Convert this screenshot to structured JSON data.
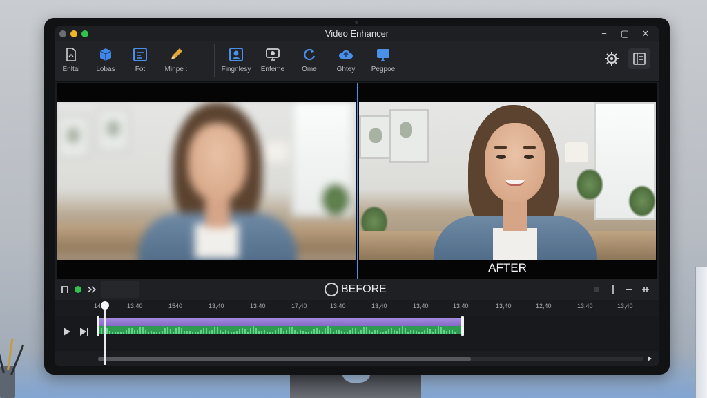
{
  "window": {
    "title": "Video Enhancer"
  },
  "toolbar": {
    "tools": [
      {
        "label": "Enltal",
        "icon": "file-icon"
      },
      {
        "label": "Lobas",
        "icon": "cube-icon"
      },
      {
        "label": "Fot",
        "icon": "format-icon"
      },
      {
        "label": "Minpe :",
        "icon": "pencil-icon"
      },
      {
        "label": "Fingnlesy",
        "icon": "portrait-icon"
      },
      {
        "label": "Enfeme",
        "icon": "monitor-icon"
      },
      {
        "label": "Ome",
        "icon": "rotate-icon"
      },
      {
        "label": "Ghtey",
        "icon": "cloud-upload-icon"
      },
      {
        "label": "Pegpoe",
        "icon": "screen-icon"
      }
    ],
    "right_icons": [
      "gear-icon",
      "panel-icon"
    ]
  },
  "viewer": {
    "after_label": "AFTER",
    "divider_color": "#4c8ee8"
  },
  "timeline": {
    "before_label": "BEFORE",
    "ruler_ticks": [
      "14",
      "13,40",
      "1540",
      "13,40",
      "13,40",
      "17,40",
      "13,40",
      "13,40",
      "13,40",
      "13,40",
      "13,40",
      "12,40",
      "13,40",
      "13,40",
      "17,40"
    ],
    "clip_colors": {
      "video": "#8f74d4",
      "audio": "#2f9a52"
    }
  }
}
